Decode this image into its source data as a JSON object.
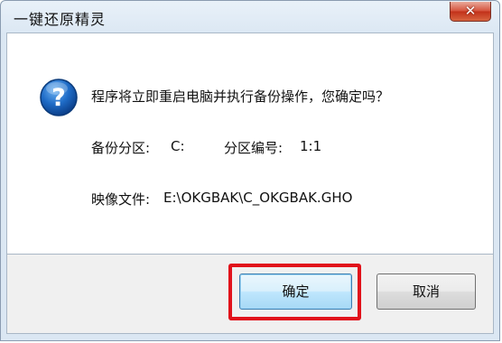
{
  "dialog": {
    "title": "一键还原精灵",
    "close_label": "✕",
    "message": "程序将立即重启电脑并执行备份操作，您确定吗？",
    "partition_label": "备份分区:",
    "partition_value": "C:",
    "partition_no_label": "分区编号:",
    "partition_no_value": "1:1",
    "image_file_label": "映像文件:",
    "image_file_value": "E:\\OKGBAK\\C_OKGBAK.GHO",
    "icon": "question-icon"
  },
  "buttons": {
    "ok_label": "确定",
    "cancel_label": "取消"
  },
  "colors": {
    "highlight": "#e1121b",
    "primary_button": "#bee6fd"
  }
}
